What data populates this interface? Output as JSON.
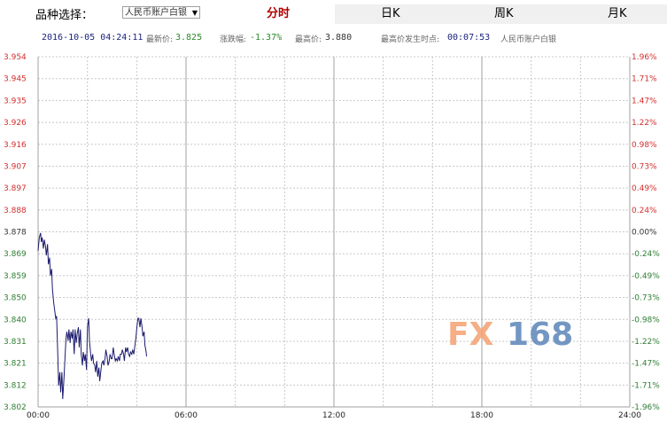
{
  "selector": {
    "label": "品种选择：",
    "value": "人民币账户白银"
  },
  "tabs": [
    {
      "label": "分时",
      "active": true
    },
    {
      "label": "日K",
      "active": false
    },
    {
      "label": "周K",
      "active": false
    },
    {
      "label": "月K",
      "active": false
    }
  ],
  "info": {
    "datetime": "2016-10-05 04:24:11",
    "latest_label": "最新价:",
    "latest_value": "3.825",
    "change_label": "涨跌幅:",
    "change_value": "-1.37%",
    "high_label": "最高价:",
    "high_value": "3.880",
    "high_time_label": "最高价发生时点:",
    "high_time_value": "00:07:53",
    "product": "人民币账户白银"
  },
  "watermark": {
    "part1": "FX",
    "part2": "168"
  },
  "colors": {
    "line": "#1a1a6e",
    "left_axis": "#2e7d32",
    "left_axis_above": "#d32f2f",
    "right_axis_up": "#d32f2f",
    "right_axis_down": "#2e7d32",
    "grid": "#c8c8c8",
    "watermark_orange": "#f4a070",
    "watermark_blue": "#5b86b8"
  },
  "chart_data": {
    "type": "line",
    "ylim": [
      3.8025,
      3.9585
    ],
    "x_ticks": [
      "00:00",
      "06:00",
      "12:00",
      "18:00",
      "24:00"
    ],
    "y_ticks_left": [
      "3.954",
      "3.945",
      "3.935",
      "3.926",
      "3.916",
      "3.907",
      "3.897",
      "3.888",
      "3.878",
      "3.869",
      "3.859",
      "3.850",
      "3.840",
      "3.831",
      "3.821",
      "3.812",
      "3.802"
    ],
    "y_ticks_right": [
      "1.96%",
      "1.71%",
      "1.47%",
      "1.22%",
      "0.98%",
      "0.73%",
      "0.49%",
      "0.24%",
      "0.00%",
      "-0.24%",
      "-0.49%",
      "-0.73%",
      "-0.98%",
      "-1.22%",
      "-1.47%",
      "-1.71%",
      "-1.96%"
    ],
    "base_price": 3.878,
    "series": [
      {
        "x_minutes": [
          0,
          3,
          6,
          8,
          10,
          13,
          15,
          18,
          20,
          23,
          25,
          28,
          30,
          33,
          35,
          38,
          40,
          43,
          45,
          48,
          50,
          53,
          55,
          58,
          60,
          63,
          65,
          68,
          70,
          73,
          75,
          78,
          80,
          83,
          85,
          88,
          90,
          93,
          95,
          98,
          100,
          103,
          105,
          108,
          110,
          113,
          115,
          118,
          120,
          123,
          125,
          128,
          130,
          133,
          135,
          138,
          140,
          143,
          145,
          148,
          150,
          153,
          155,
          158,
          160,
          163,
          165,
          168,
          170,
          173,
          175,
          178,
          180,
          183,
          185,
          188,
          190,
          193,
          195,
          198,
          200,
          203,
          205,
          208,
          210,
          213,
          215,
          218,
          220,
          223,
          225,
          228,
          230,
          233,
          235,
          238,
          240,
          243,
          245,
          248,
          250,
          253,
          255,
          258,
          260,
          263,
          264
        ],
        "values": [
          3.872,
          3.878,
          3.88,
          3.876,
          3.878,
          3.873,
          3.877,
          3.874,
          3.87,
          3.875,
          3.866,
          3.869,
          3.861,
          3.864,
          3.855,
          3.849,
          3.846,
          3.842,
          3.843,
          3.825,
          3.812,
          3.818,
          3.809,
          3.818,
          3.806,
          3.815,
          3.823,
          3.833,
          3.836,
          3.832,
          3.837,
          3.831,
          3.836,
          3.833,
          3.837,
          3.826,
          3.837,
          3.831,
          3.835,
          3.838,
          3.829,
          3.837,
          3.826,
          3.821,
          3.827,
          3.823,
          3.826,
          3.819,
          3.838,
          3.842,
          3.832,
          3.826,
          3.823,
          3.826,
          3.822,
          3.821,
          3.818,
          3.823,
          3.816,
          3.82,
          3.814,
          3.819,
          3.822,
          3.823,
          3.821,
          3.824,
          3.828,
          3.825,
          3.821,
          3.823,
          3.826,
          3.824,
          3.824,
          3.829,
          3.826,
          3.823,
          3.824,
          3.823,
          3.825,
          3.823,
          3.826,
          3.826,
          3.828,
          3.826,
          3.823,
          3.829,
          3.827,
          3.829,
          3.826,
          3.825,
          3.827,
          3.826,
          3.828,
          3.826,
          3.829,
          3.833,
          3.837,
          3.842,
          3.842,
          3.838,
          3.842,
          3.838,
          3.834,
          3.836,
          3.83,
          3.827,
          3.825
        ]
      }
    ]
  }
}
